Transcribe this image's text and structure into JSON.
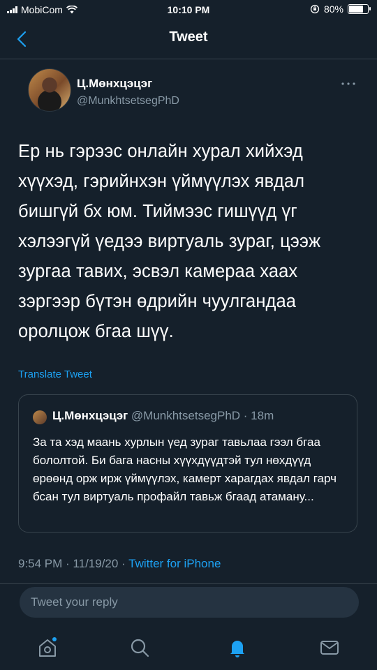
{
  "status_bar": {
    "carrier": "MobiCom",
    "time": "10:10 PM",
    "battery": "80%",
    "battery_level": 0.8
  },
  "nav": {
    "title": "Tweet",
    "back_icon": "chevron-left-icon"
  },
  "tweet": {
    "author_name": "Ц.Мөнхцэцэг",
    "author_handle": "@MunkhtsetsegPhD",
    "more_icon": "more-horizontal-icon",
    "text": "Ер нь гэрээс онлайн хурал хийхэд хүүхэд, гэрийнхэн үймүүлэх явдал бишгүй бх юм. Тиймээс гишүүд үг хэлээгүй үедээ виртуаль зураг, цээж зургаа тавих, эсвэл камераа хаах зэргээр бүтэн өдрийн чуулгандаа оролцож бгаа шүү.",
    "translate_label": "Translate Tweet",
    "timestamp": "9:54 PM · 11/19/20 · ",
    "source": "Twitter for iPhone"
  },
  "quoted_tweet": {
    "author_name": "Ц.Мөнхцэцэг",
    "meta": " @MunkhtsetsegPhD · 18m",
    "text": "За та хэд маань хурлын үед зураг тавьлаа гээл бгаа бололтой. Би бага насны хүүхдүүдтэй тул нөхдүүд өрөөнд орж ирж үймүүлэх, камерт харагдах явдал гарч бсан тул виртуаль профайл тавьж бгаад атаману..."
  },
  "reply": {
    "placeholder": "Tweet your reply"
  },
  "tabbar": {
    "items": [
      "home-icon",
      "search-icon",
      "notifications-icon",
      "messages-icon"
    ],
    "active": "notifications-icon"
  },
  "colors": {
    "background": "#15202b",
    "accent": "#1da1f2",
    "secondary_text": "#8899a6",
    "border": "#38444d"
  }
}
